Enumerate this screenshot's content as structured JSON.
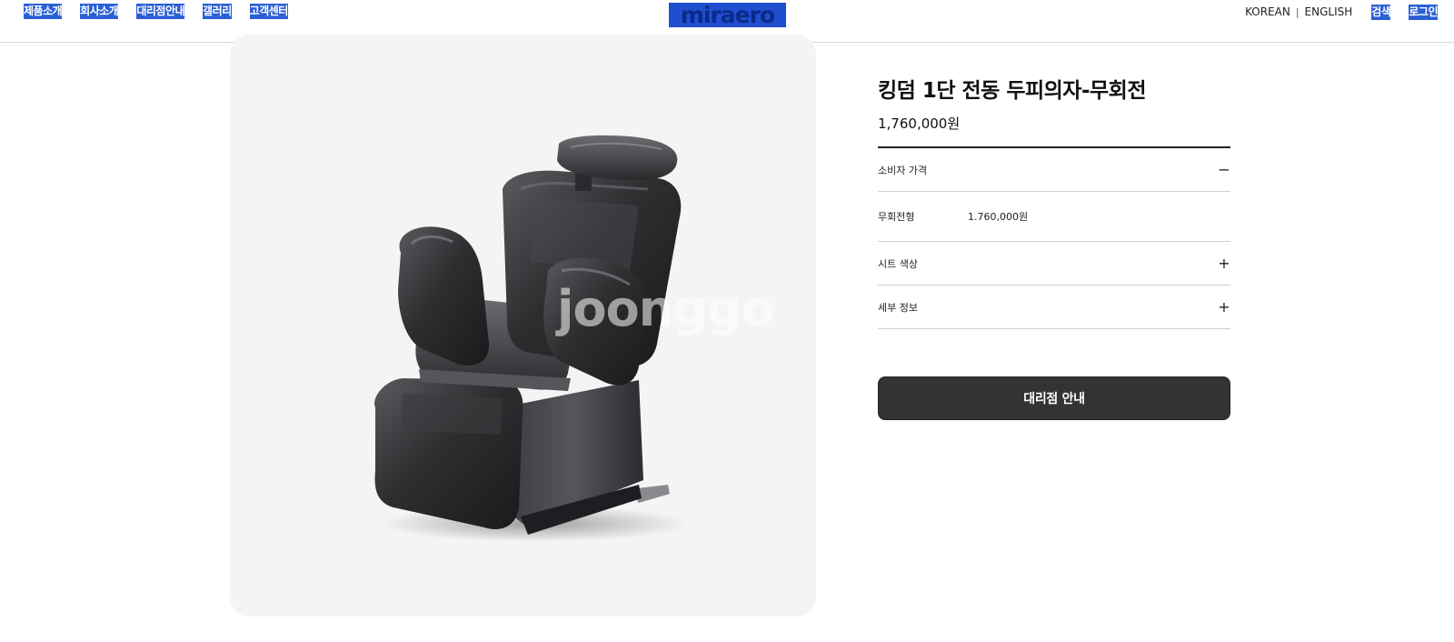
{
  "header": {
    "nav": [
      "제품소개",
      "회사소개",
      "대리점안내",
      "갤러리",
      "고객센터"
    ],
    "logo_text": "miraero",
    "lang_korean": "KOREAN",
    "lang_separator": "|",
    "lang_english": "ENGLISH",
    "search_label": "검색",
    "login_label": "로그인"
  },
  "product": {
    "title": "킹덤 1단 전동 두피의자-무회전",
    "price": "1,760,000원",
    "accordion": {
      "consumer_price_label": "소비자 가격",
      "consumer_price_toggle": "−",
      "option_name": "무회전형",
      "option_price": "1.760,000원",
      "seat_color_label": "시트 색상",
      "seat_color_toggle": "+",
      "detail_info_label": "세부 정보",
      "detail_info_toggle": "+"
    },
    "cta_label": "대리점 안내"
  },
  "colors": {
    "nav_highlight": "#2a5fd6",
    "cta_bg": "#333333",
    "image_bg": "#f4f4f4"
  },
  "icons": [
    "minus-icon",
    "plus-icon"
  ]
}
